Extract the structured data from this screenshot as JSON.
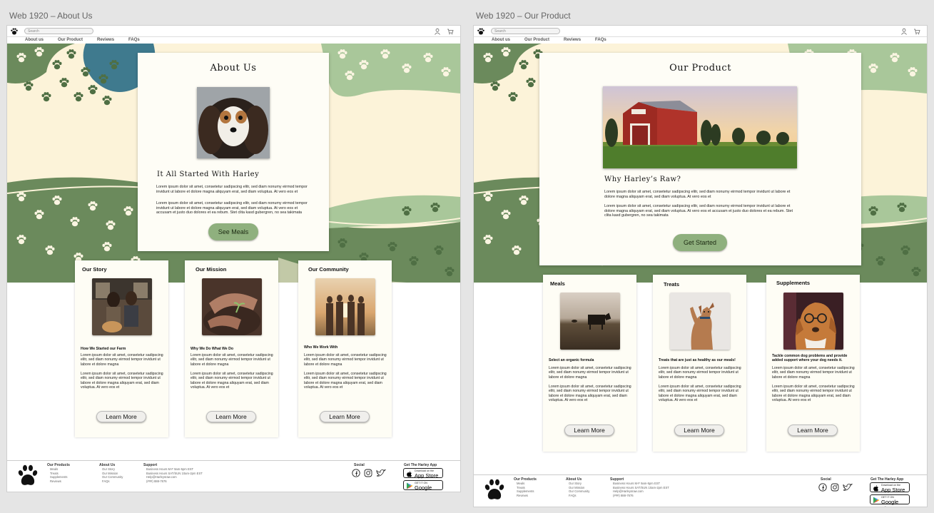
{
  "artboards": [
    {
      "label": "Web 1920 – About Us",
      "search_placeholder": "Search",
      "nav": [
        "About us",
        "Our Product",
        "Reviews",
        "FAQs"
      ],
      "main": {
        "title": "About Us",
        "photo": "cavalier-dog-photo",
        "subtitle": "It All Started With Harley",
        "para1": "Lorem ipsum dolor sit amet, consetetur sadipscing elitr, sed diam nonumy eirmod tempor invidunt ut labore et dolore magna aliquyam erat, sed diam voluptua. At vero eos et",
        "para2": "Lorem ipsum dolor sit amet, consetetur sadipscing elitr, sed diam nonumy eirmod tempor invidunt ut labore et dolore magna aliquyam erat, sed diam voluptua. At vero eos et accusam et justo duo dolores et ea rebum. Stet clita kasd gubergren, no sea takimata",
        "button": "See Meals"
      },
      "cards": [
        {
          "title": "Our Story",
          "heading": "How We Started our Farm",
          "text1": "Lorem ipsum dolor sit amet, consetetur sadipscing elitr, sed diam nonumy eirmod tempor invidunt ut labore et dolore magna",
          "text2": "Lorem ipsum dolor sit amet, consetetur sadipscing elitr, sed diam nonumy eirmod tempor invidunt ut labore et dolore magna aliquyam erat, sed diam voluptua. At vero eos et",
          "button": "Learn More"
        },
        {
          "title": "Our Mission",
          "heading": "Why We Do What We Do",
          "text1": "Lorem ipsum dolor sit amet, consetetur sadipscing elitr, sed diam nonumy eirmod tempor invidunt ut labore et dolore magna",
          "text2": "Lorem ipsum dolor sit amet, consetetur sadipscing elitr, sed diam nonumy eirmod tempor invidunt ut labore et dolore magna aliquyam erat, sed diam voluptua. At vero eos et",
          "button": "Learn More"
        },
        {
          "title": "Our Community",
          "heading": "Who We Work With",
          "text1": "Lorem ipsum dolor sit amet, consetetur sadipscing elitr, sed diam nonumy eirmod tempor invidunt ut labore et dolore magna",
          "text2": "Lorem ipsum dolor sit amet, consetetur sadipscing elitr, sed diam nonumy eirmod tempor invidunt ut labore et dolore magna aliquyam erat, sed diam voluptua. At vero eos et",
          "button": "Learn More"
        }
      ]
    },
    {
      "label": "Web 1920 – Our Product",
      "search_placeholder": "Search",
      "nav": [
        "About us",
        "Our Product",
        "Reviews",
        "FAQs"
      ],
      "main": {
        "title": "Our Product",
        "photo": "red-barn-photo",
        "subtitle": "Why Harley’s Raw?",
        "para1": "Lorem ipsum dolor sit amet, consetetur sadipscing elitr, sed diam nonumy eirmod tempor invidunt ut labore et dolore magna aliquyam erat, sed diam voluptua. At vero eos et",
        "para2": "Lorem ipsum dolor sit amet, consetetur sadipscing elitr, sed diam nonumy eirmod tempor invidunt ut labore et dolore magna aliquyam erat, sed diam voluptua. At vero eos et accusam et justo duo dolores et ea rebum. Stet clita kasd gubergren, no sea takimata",
        "button": "Get Started"
      },
      "cards": [
        {
          "title": "Meals",
          "heading": "Select an organic formula",
          "text1": "Lorem ipsum dolor sit amet, consetetur sadipscing elitr, sed diam nonumy eirmod tempor invidunt ut labore et dolore magna",
          "text2": "Lorem ipsum dolor sit amet, consetetur sadipscing elitr, sed diam nonumy eirmod tempor invidunt ut labore et dolore magna aliquyam erat, sed diam voluptua. At vero eos et",
          "button": "Learn More"
        },
        {
          "title": "Treats",
          "heading": "Treats that are just as healthy as our meals!",
          "text1": "Lorem ipsum dolor sit amet, consetetur sadipscing elitr, sed diam nonumy eirmod tempor invidunt ut labore et dolore magna",
          "text2": "Lorem ipsum dolor sit amet, consetetur sadipscing elitr, sed diam nonumy eirmod tempor invidunt ut labore et dolore magna aliquyam erat, sed diam voluptua. At vero eos et",
          "button": "Learn More"
        },
        {
          "title": "Supplements",
          "heading": "Tackle common dog problems and provide added support where your dog needs it.",
          "text1": "Lorem ipsum dolor sit amet, consetetur sadipscing elitr, sed diam nonumy eirmod tempor invidunt ut labore et dolore magna",
          "text2": "Lorem ipsum dolor sit amet, consetetur sadipscing elitr, sed diam nonumy eirmod tempor invidunt ut labore et dolore magna aliquyam erat, sed diam voluptua. At vero eos et",
          "button": "Learn More"
        }
      ]
    }
  ],
  "footer": {
    "products_head": "Our Products",
    "products": [
      "Meals",
      "Treats",
      "Supplements",
      "Reviews"
    ],
    "about_head": "About Us",
    "about": [
      "Our Story",
      "Our Mission",
      "Our Community",
      "FAQs"
    ],
    "support_head": "Support",
    "support": [
      "Business Hours M-F 9am-5pm EST",
      "Business Hours SAT/SUN 10am-2pm EST",
      "Help@Harleysraw.com",
      "(###) 888-7676"
    ],
    "social_head": "Social",
    "app_head": "Get The Harley App",
    "appstore_small": "Download on the",
    "appstore_big": "App Store",
    "googleplay_small": "GET IT ON",
    "googleplay_big": "Google Play"
  },
  "colors": {
    "cream": "#fcf3d9",
    "green_dark": "#6b8a5c",
    "green_light": "#a9c79a",
    "teal": "#3f7a8e",
    "button_green": "#8fb07e"
  }
}
